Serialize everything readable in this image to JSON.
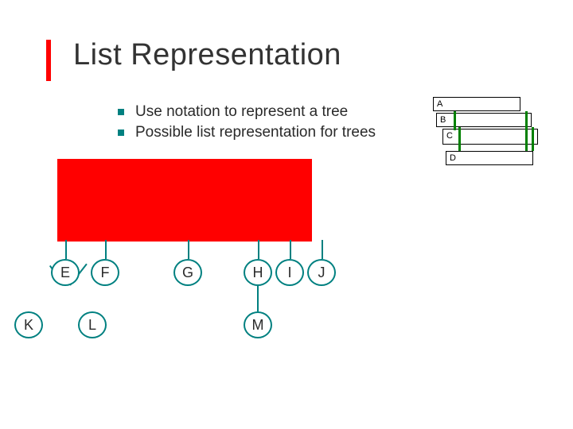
{
  "title": "List Representation",
  "bullets": [
    "Use notation to represent a tree",
    "Possible list representation for trees"
  ],
  "right_boxes": {
    "a": "A",
    "b": "B",
    "c": "C",
    "d": "D"
  },
  "tree": {
    "row_mid": {
      "E": "E",
      "F": "F",
      "G": "G",
      "H": "H",
      "I": "I",
      "J": "J"
    },
    "row_bot": {
      "K": "K",
      "L": "L",
      "M": "M"
    }
  },
  "colors": {
    "accent_red": "#ff0000",
    "node_teal": "#008080",
    "connector_green": "#008000"
  }
}
